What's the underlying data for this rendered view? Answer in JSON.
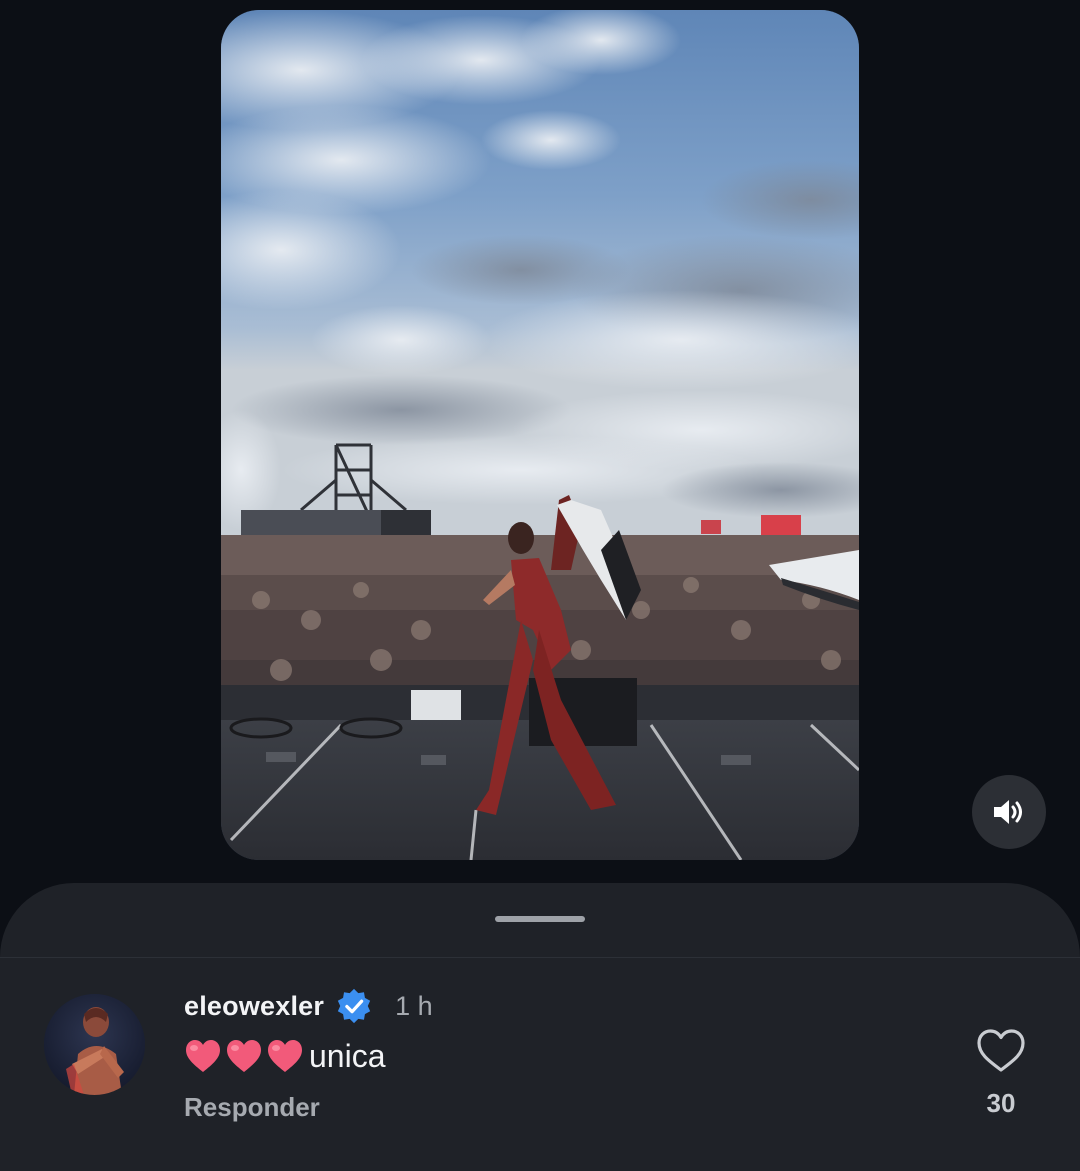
{
  "media": {
    "description_icon": "concert-stage-photo",
    "mute_icon": "speaker-icon"
  },
  "sheet": {
    "handle_icon": "drag-handle"
  },
  "comment": {
    "username": "eleowexler",
    "verified_icon": "verified-badge-icon",
    "time": "1 h",
    "emojis": [
      "heart-emoji",
      "heart-emoji",
      "heart-emoji"
    ],
    "text": "unica",
    "reply_label": "Responder",
    "like_icon": "heart-outline-icon",
    "like_count": "30"
  },
  "colors": {
    "background": "#0c0f15",
    "sheet": "#1f2228",
    "verified": "#3b8ff0",
    "heart": "#f25a7a"
  }
}
